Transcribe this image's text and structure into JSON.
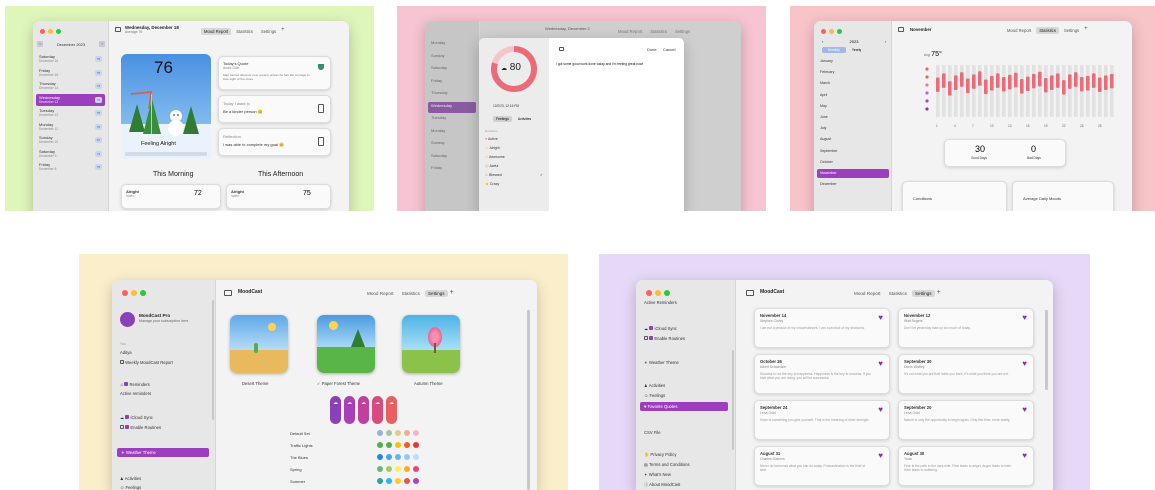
{
  "colors": {
    "panel1": "#dff6bb",
    "panel2": "#f7c4d3",
    "panel3": "#f7c4c8",
    "panel4": "#fbefcb",
    "panel5": "#e5d9f7",
    "accent": "#9c3fbf",
    "heart": "#8a2fb5"
  },
  "p1": {
    "title": "Wednesday, December 18",
    "subtitle": "Average 75",
    "tabs": [
      "Mood Report",
      "Statistics",
      "Settings"
    ],
    "month": "December",
    "year": "2023",
    "days": [
      {
        "day": "Saturday",
        "date": "December 16",
        "badge": "75"
      },
      {
        "day": "Friday",
        "date": "December 15",
        "badge": "75"
      },
      {
        "day": "Thursday",
        "date": "December 14",
        "badge": "72"
      },
      {
        "day": "Wednesday",
        "date": "December 13",
        "badge": "75"
      },
      {
        "day": "Tuesday",
        "date": "December 12",
        "badge": "75"
      },
      {
        "day": "Monday",
        "date": "December 11",
        "badge": "76"
      },
      {
        "day": "Sunday",
        "date": "December 10",
        "badge": "67"
      },
      {
        "day": "Saturday",
        "date": "December 9",
        "badge": "71"
      },
      {
        "day": "Friday",
        "date": "December 8",
        "badge": "75"
      }
    ],
    "hero_temp": "76",
    "hero_label": "Feeling Alright",
    "quote_title": "Today's Quote",
    "quote_author": "Andre Gide",
    "quote_text": "Man cannot discover new oceans unless he has the courage to lose sight of the shore.",
    "want_title": "Today I want to",
    "want_text": "Be a kinder person 😊",
    "reflection_title": "Reflection",
    "reflection_text": "I was able to complete my goal 😊",
    "morning": "This Morning",
    "afternoon": "This Afternoon",
    "morning_mood": "Alright",
    "morning_sub": "Index",
    "morning_value": "72",
    "afternoon_mood": "Alright",
    "afternoon_sub": "Index",
    "afternoon_value": "75"
  },
  "p2": {
    "title": "Wednesday, December 2",
    "tabs": [
      "Mood Report",
      "Statistics",
      "Settings"
    ],
    "ring_value": "80",
    "datetime": "12/2/23, 12:16 PM",
    "seg": [
      "Feelings",
      "Activities"
    ],
    "emotions_label": "Emotions",
    "emotions": [
      "Active",
      "Alright",
      "Awesome",
      "Awful",
      "Blessed",
      "Crazy"
    ],
    "done": "Done",
    "cancel": "Cancel",
    "note": "I got some good work done today and I'm feeling great now!",
    "side_days": [
      "Monday",
      "Sunday",
      "Saturday",
      "Friday",
      "Thursday",
      "Wednesday",
      "Tuesday",
      "Monday",
      "Sunday",
      "Saturday",
      "Friday"
    ],
    "selected_side": "Wednesday"
  },
  "p3": {
    "title": "November",
    "tabs": [
      "Mood Report",
      "Statistics",
      "Settings"
    ],
    "year": "2023",
    "seg": [
      "Monthly",
      "Yearly"
    ],
    "months": [
      "January",
      "February",
      "March",
      "April",
      "May",
      "June",
      "July",
      "August",
      "September",
      "October",
      "November",
      "December"
    ],
    "selected_month": "November",
    "avg_label": "Avg",
    "avg_value": "75°",
    "good_days_value": "30",
    "good_days_label": "Good Days",
    "bad_days_value": "0",
    "bad_days_label": "Bad Days",
    "card_a": "Conditions",
    "card_b": "Average Daily Moods",
    "bars": [
      0.62,
      0.7,
      0.55,
      0.66,
      0.72,
      0.6,
      0.68,
      0.74,
      0.58,
      0.65,
      0.7,
      0.63,
      0.67,
      0.71,
      0.59,
      0.64,
      0.69,
      0.73,
      0.61,
      0.66,
      0.7,
      0.57,
      0.68,
      0.72,
      0.63,
      0.65,
      0.7,
      0.62,
      0.66,
      0.69
    ],
    "x_ticks": [
      "1",
      "4",
      "7",
      "10",
      "13",
      "16",
      "19",
      "22",
      "25",
      "28"
    ]
  },
  "p4": {
    "title": "MoodCast",
    "tabs": [
      "Mood Report",
      "Statistics",
      "Settings"
    ],
    "pro_title": "MoodCast Pro",
    "pro_sub": "Manage your subscription here",
    "you_label": "You",
    "name": "Aditya",
    "weekly": "Weekly MoodCast Report",
    "reminders": "Reminders",
    "active_reminders": "Active reminders",
    "icloud": "iCloud Sync",
    "routines": "Enable Routines",
    "weather_theme": "Weather Theme",
    "activities": "Activities",
    "feelings": "Feelings",
    "themes": [
      "Desert Theme",
      "Paper Forest Theme",
      "Autumn Theme"
    ],
    "selected_theme": "Paper Forest Theme",
    "palettes": [
      "Default Set",
      "Traffic Lights",
      "The Blues",
      "Spring",
      "Summer"
    ],
    "palette_colors": [
      [
        "#8fb4d9",
        "#a7c3a0",
        "#d9d08f",
        "#e8b08a",
        "#f0b7c9"
      ],
      [
        "#4caf50",
        "#4caf50",
        "#ffc107",
        "#ff5722",
        "#e53935"
      ],
      [
        "#1e88e5",
        "#42a5f5",
        "#64b5f6",
        "#90caf9",
        "#bbdefb"
      ],
      [
        "#66bb6a",
        "#9ccc65",
        "#ffee58",
        "#ffa726",
        "#ec407a"
      ],
      [
        "#26a69a",
        "#29b6f6",
        "#ffca28",
        "#ef5350",
        "#ab47bc"
      ]
    ],
    "pill_colors": [
      "#8b3fb8",
      "#a93fb5",
      "#c23f9e",
      "#d84b7d",
      "#e8605f"
    ]
  },
  "p5": {
    "title": "MoodCast",
    "tabs": [
      "Mood Report",
      "Statistics",
      "Settings"
    ],
    "side": {
      "active_reminders": "Active Reminders",
      "icloud": "iCloud Sync",
      "routines": "Enable Routines",
      "weather_theme": "Weather Theme",
      "activities": "Activities",
      "feelings": "Feelings",
      "favorite_quotes": "Favorite Quotes",
      "csv": "CSV File",
      "privacy": "Privacy Policy",
      "terms": "Terms and Conditions",
      "whats_new": "What's New",
      "about": "About MoodCast"
    },
    "quotes": [
      {
        "date": "November 14",
        "author": "Stephen Covey",
        "text": "I am not a product of my circumstances. I am a product of my decisions."
      },
      {
        "date": "November 12",
        "author": "Walt Rogers",
        "text": "Don't let yesterday take up too much of today."
      },
      {
        "date": "October 26",
        "author": "Albert Schweitzer",
        "text": "Success is not the key to happiness. Happiness is the key to success. If you love what you are doing, you will be successful."
      },
      {
        "date": "September 30",
        "author": "Denis Waitley",
        "text": "It's not what you are that holds you back, it's what you think you are not."
      },
      {
        "date": "September 24",
        "author": "Lena Gold",
        "text": "Hope is something you give yourself. That is the meaning of inner strength."
      },
      {
        "date": "September 20",
        "author": "Lena Gold",
        "text": "Nature is only the opportunity to begin again. Only this time, more wisely."
      },
      {
        "date": "August 31",
        "author": "Charles Dickens",
        "text": "Never do tomorrow what you can do today. Procrastination is the thief of time."
      },
      {
        "date": "August 30",
        "author": "Yoda",
        "text": "Fear is the path to the dark side. Fear leads to anger. Anger leads to hate. Hate leads to suffering."
      }
    ]
  }
}
